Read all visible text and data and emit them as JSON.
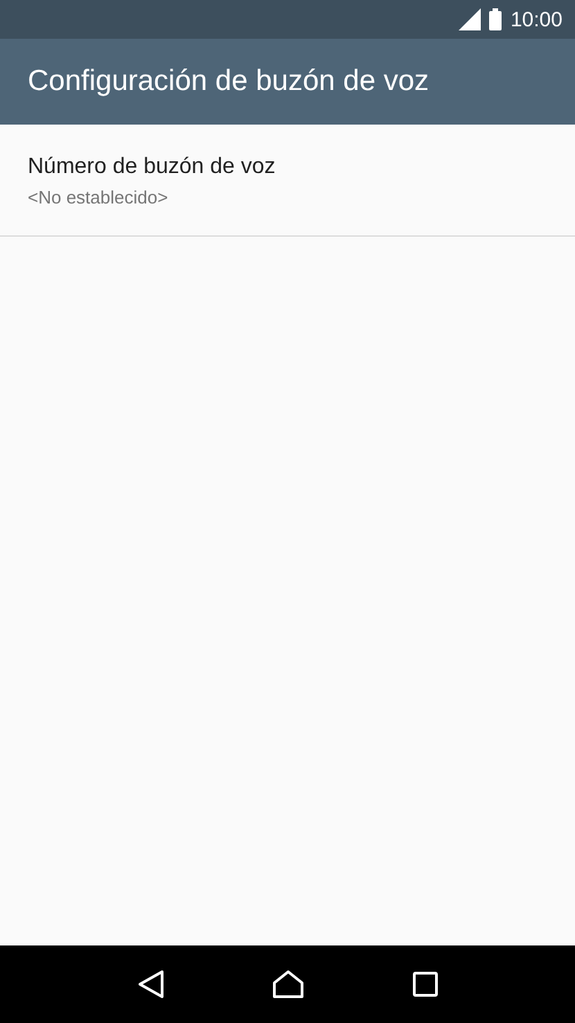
{
  "status_bar": {
    "time": "10:00"
  },
  "app_bar": {
    "title": "Configuración de buzón de voz"
  },
  "settings": [
    {
      "title": "Número de buzón de voz",
      "summary": "<No establecido>"
    }
  ]
}
